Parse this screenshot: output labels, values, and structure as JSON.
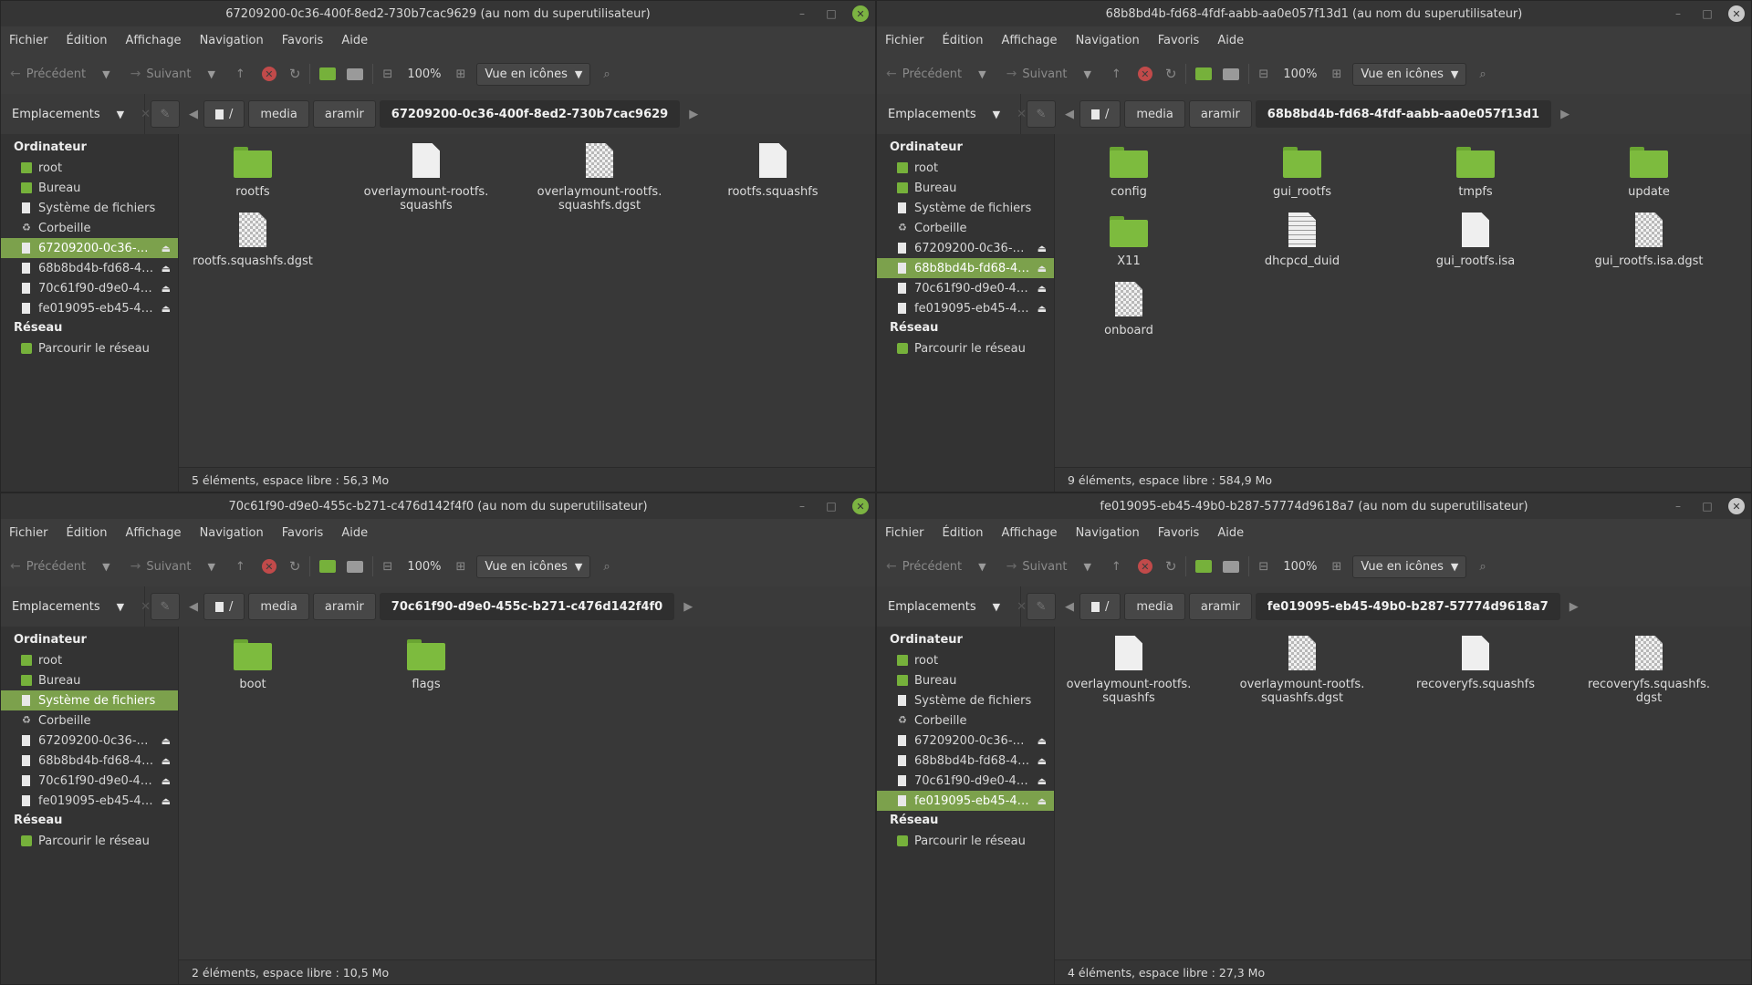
{
  "menu": [
    "Fichier",
    "Édition",
    "Affichage",
    "Navigation",
    "Favoris",
    "Aide"
  ],
  "toolbar": {
    "back": "Précédent",
    "forward": "Suivant",
    "zoom": "100%",
    "view": "Vue en icônes"
  },
  "places_label": "Emplacements",
  "sidebar": {
    "computer": "Ordinateur",
    "root": "root",
    "desktop": "Bureau",
    "filesystem": "Système de fichiers",
    "trash": "Corbeille",
    "drives": [
      "67209200-0c36-40…",
      "68b8bd4b-fd68-4fd…",
      "70c61f90-d9e0-455…",
      "fe019095-eb45-49…"
    ],
    "network": "Réseau",
    "browse_network": "Parcourir le réseau"
  },
  "crumbs": {
    "root": "/",
    "media": "media",
    "user": "aramir"
  },
  "colors": {
    "accent": "#7ca14c",
    "close_green": "#7cb342",
    "close_gray": "#c8c8c8",
    "stop_red": "#c14a4a"
  },
  "windows": [
    {
      "title": "67209200-0c36-400f-8ed2-730b7cac9629 (au nom du superutilisateur)",
      "current": "67209200-0c36-400f-8ed2-730b7cac9629",
      "status": "5 éléments, espace libre : 56,3 Mo",
      "selected": "drive0",
      "files": [
        {
          "name": "rootfs",
          "type": "folder"
        },
        {
          "name": "overlaymount-rootfs.\nsquashfs",
          "type": "doc"
        },
        {
          "name": "overlaymount-rootfs.\nsquashfs.dgst",
          "type": "bin"
        },
        {
          "name": "rootfs.squashfs",
          "type": "doc"
        },
        {
          "name": "rootfs.squashfs.dgst",
          "type": "bin"
        }
      ]
    },
    {
      "title": "68b8bd4b-fd68-4fdf-aabb-aa0e057f13d1 (au nom du superutilisateur)",
      "current": "68b8bd4b-fd68-4fdf-aabb-aa0e057f13d1",
      "status": "9 éléments, espace libre : 584,9 Mo",
      "selected": "drive1",
      "files": [
        {
          "name": "config",
          "type": "folder"
        },
        {
          "name": "gui_rootfs",
          "type": "folder"
        },
        {
          "name": "tmpfs",
          "type": "folder"
        },
        {
          "name": "update",
          "type": "folder"
        },
        {
          "name": "X11",
          "type": "folder"
        },
        {
          "name": "dhcpcd_duid",
          "type": "txt"
        },
        {
          "name": "gui_rootfs.isa",
          "type": "doc"
        },
        {
          "name": "gui_rootfs.isa.dgst",
          "type": "bin"
        },
        {
          "name": "onboard",
          "type": "bin"
        }
      ]
    },
    {
      "title": "70c61f90-d9e0-455c-b271-c476d142f4f0 (au nom du superutilisateur)",
      "current": "70c61f90-d9e0-455c-b271-c476d142f4f0",
      "status": "2 éléments, espace libre : 10,5 Mo",
      "selected": "filesystem",
      "files": [
        {
          "name": "boot",
          "type": "folder"
        },
        {
          "name": "flags",
          "type": "folder"
        }
      ]
    },
    {
      "title": "fe019095-eb45-49b0-b287-57774d9618a7 (au nom du superutilisateur)",
      "current": "fe019095-eb45-49b0-b287-57774d9618a7",
      "status": "4 éléments, espace libre : 27,3 Mo",
      "selected": "drive3",
      "files": [
        {
          "name": "overlaymount-rootfs.\nsquashfs",
          "type": "doc"
        },
        {
          "name": "overlaymount-rootfs.\nsquashfs.dgst",
          "type": "bin"
        },
        {
          "name": "recoveryfs.squashfs",
          "type": "doc"
        },
        {
          "name": "recoveryfs.squashfs.\ndgst",
          "type": "bin"
        }
      ]
    }
  ]
}
